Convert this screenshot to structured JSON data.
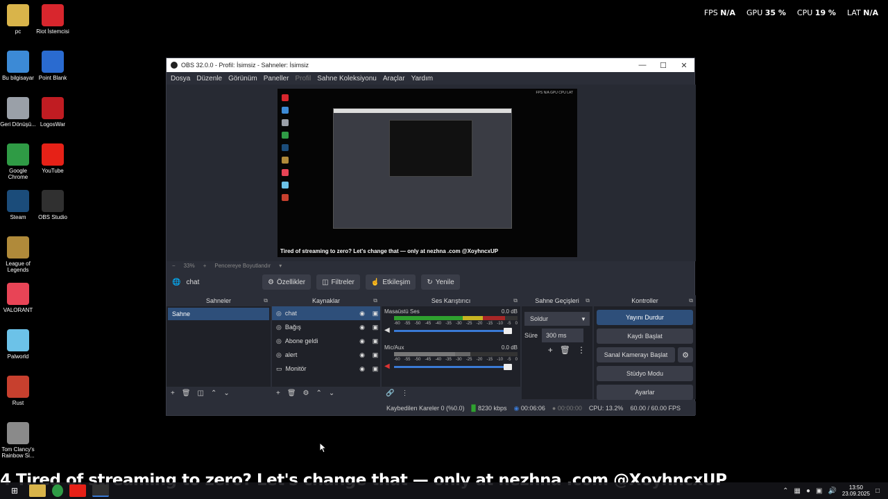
{
  "overlay": {
    "fps_label": "FPS",
    "fps_value": "N/A",
    "gpu_label": "GPU",
    "gpu_value": "35 %",
    "cpu_label": "CPU",
    "cpu_value": "19 %",
    "lat_label": "LAT",
    "lat_value": "N/A"
  },
  "desktop_icons": [
    {
      "label": "pc",
      "icon": "folder-user-icon",
      "color": "#d9b44a"
    },
    {
      "label": "Riot İstemcisi",
      "icon": "riot-icon",
      "color": "#d8262d"
    },
    {
      "label": "Bu bilgisayar",
      "icon": "computer-icon",
      "color": "#3c8ad6"
    },
    {
      "label": "Point Blank",
      "icon": "point-blank-icon",
      "color": "#2a6bd0"
    },
    {
      "label": "Geri Dönüşü...",
      "icon": "recycle-bin-icon",
      "color": "#9aa0a8"
    },
    {
      "label": "LogosWar",
      "icon": "logoswar-icon",
      "color": "#c01c22"
    },
    {
      "label": "Google Chrome",
      "icon": "chrome-icon",
      "color": "#2f9b45"
    },
    {
      "label": "YouTube",
      "icon": "youtube-icon",
      "color": "#e62117"
    },
    {
      "label": "Steam",
      "icon": "steam-icon",
      "color": "#1b4c7a"
    },
    {
      "label": "OBS Studio",
      "icon": "obs-icon",
      "color": "#303030"
    },
    {
      "label": "League of Legends",
      "icon": "lol-icon",
      "color": "#b08a3a"
    },
    {
      "label": "VALORANT",
      "icon": "valorant-icon",
      "color": "#e84456"
    },
    {
      "label": "Palworld",
      "icon": "palworld-icon",
      "color": "#6cc2e8"
    },
    {
      "label": "Rust",
      "icon": "rust-icon",
      "color": "#c7402e"
    },
    {
      "label": "Tom Clancy's Rainbow Si...",
      "icon": "rainbow-six-icon",
      "color": "#8a8a8a"
    }
  ],
  "window": {
    "title": "OBS 32.0.0 - Profil: İsimsiz - Sahneler: İsimsiz",
    "menu": [
      "Dosya",
      "Düzenle",
      "Görünüm",
      "Paneller",
      "Profil",
      "Sahne Koleksiyonu",
      "Araçlar",
      "Yardım"
    ]
  },
  "preview": {
    "zoom": "33%",
    "fit_label": "Pencereye Boyutlandır",
    "ticker": "Tired of streaming to zero? Let's change that — only at nezhna .com @XoyhncxUP"
  },
  "source_bar": {
    "current": "chat",
    "buttons": [
      "Özellikler",
      "Filtreler",
      "Etkileşim",
      "Yenile"
    ]
  },
  "scenes": {
    "title": "Sahneler",
    "items": [
      "Sahne"
    ]
  },
  "sources": {
    "title": "Kaynaklar",
    "items": [
      {
        "name": "chat",
        "icon": "browser-icon"
      },
      {
        "name": "Bağış",
        "icon": "browser-icon"
      },
      {
        "name": "Abone geldi",
        "icon": "browser-icon"
      },
      {
        "name": "alert",
        "icon": "browser-icon"
      },
      {
        "name": "Monitör",
        "icon": "display-capture-icon"
      }
    ]
  },
  "mixer": {
    "title": "Ses Karıştırıcı",
    "channels": [
      {
        "name": "Masaüstü Ses",
        "db": "0.0 dB",
        "level": 0.9,
        "muted": false
      },
      {
        "name": "Mic/Aux",
        "db": "0.0 dB",
        "level": 0.62,
        "muted": true
      }
    ],
    "scale": [
      "-60",
      "-55",
      "-50",
      "-45",
      "-40",
      "-35",
      "-30",
      "-25",
      "-20",
      "-15",
      "-10",
      "-5",
      "0"
    ]
  },
  "transitions": {
    "title": "Sahne Geçişleri",
    "selected": "Soldur",
    "duration_label": "Süre",
    "duration": "300 ms"
  },
  "controls": {
    "title": "Kontroller",
    "stream": "Yayını Durdur",
    "record": "Kaydı Başlat",
    "virtual_cam": "Sanal Kamerayı Başlat",
    "studio": "Stüdyo Modu",
    "settings": "Ayarlar"
  },
  "status": {
    "dropped": "Kaybedilen Kareler 0 (%0.0)",
    "bitrate": "8230 kbps",
    "stream_time": "00:06:06",
    "rec_time": "00:00:00",
    "cpu": "CPU: 13.2%",
    "fps": "60.00 / 60.00 FPS"
  },
  "desktop_ticker": "4 Tired of streaming to zero? Let's change that — only at nezhna .com @XoyhncxUP",
  "clock": {
    "time": "13:50",
    "date": "23.09.2025"
  }
}
